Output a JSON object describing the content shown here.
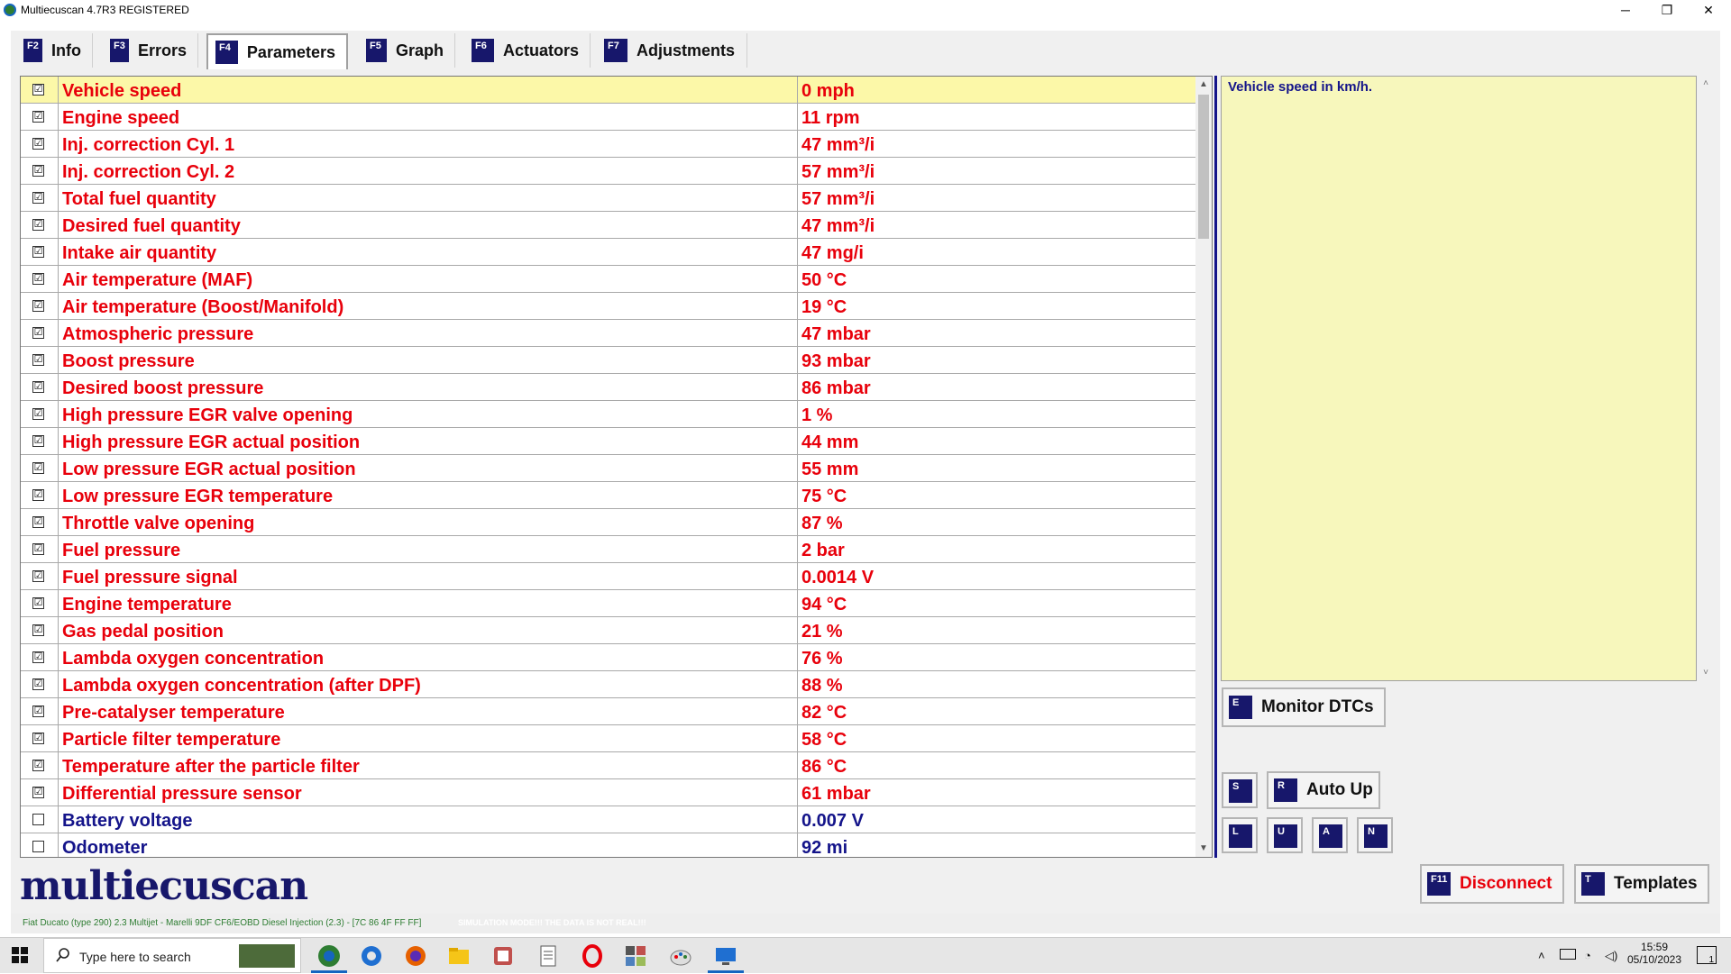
{
  "window": {
    "title": "Multiecuscan 4.7R3 REGISTERED",
    "minimize_glyph": "─",
    "maximize_glyph": "❐",
    "close_glyph": "✕"
  },
  "tabs": [
    {
      "key": "F2",
      "label": "Info"
    },
    {
      "key": "F3",
      "label": "Errors"
    },
    {
      "key": "F4",
      "label": "Parameters"
    },
    {
      "key": "F5",
      "label": "Graph"
    },
    {
      "key": "F6",
      "label": "Actuators"
    },
    {
      "key": "F7",
      "label": "Adjustments"
    }
  ],
  "parameters": [
    {
      "name": "Vehicle speed",
      "value": "0 mph",
      "checked": true,
      "selected": true
    },
    {
      "name": "Engine speed",
      "value": "11 rpm",
      "checked": true
    },
    {
      "name": "Inj. correction Cyl. 1",
      "value": "47 mm³/i",
      "checked": true
    },
    {
      "name": "Inj. correction Cyl. 2",
      "value": "57 mm³/i",
      "checked": true
    },
    {
      "name": "Total fuel quantity",
      "value": "57 mm³/i",
      "checked": true
    },
    {
      "name": "Desired fuel quantity",
      "value": "47 mm³/i",
      "checked": true
    },
    {
      "name": "Intake air quantity",
      "value": "47 mg/i",
      "checked": true
    },
    {
      "name": "Air temperature (MAF)",
      "value": "50 °C",
      "checked": true
    },
    {
      "name": "Air temperature (Boost/Manifold)",
      "value": "19 °C",
      "checked": true
    },
    {
      "name": "Atmospheric pressure",
      "value": "47 mbar",
      "checked": true
    },
    {
      "name": "Boost pressure",
      "value": "93 mbar",
      "checked": true
    },
    {
      "name": "Desired boost pressure",
      "value": "86 mbar",
      "checked": true
    },
    {
      "name": "High pressure EGR valve opening",
      "value": "1 %",
      "checked": true
    },
    {
      "name": "High pressure EGR actual position",
      "value": "44 mm",
      "checked": true
    },
    {
      "name": "Low pressure EGR actual position",
      "value": "55 mm",
      "checked": true
    },
    {
      "name": "Low pressure EGR temperature",
      "value": "75 °C",
      "checked": true
    },
    {
      "name": "Throttle valve opening",
      "value": "87 %",
      "checked": true
    },
    {
      "name": "Fuel pressure",
      "value": "2 bar",
      "checked": true
    },
    {
      "name": "Fuel pressure signal",
      "value": "0.0014 V",
      "checked": true
    },
    {
      "name": "Engine temperature",
      "value": "94 °C",
      "checked": true
    },
    {
      "name": "Gas pedal position",
      "value": "21 %",
      "checked": true
    },
    {
      "name": "Lambda oxygen concentration",
      "value": "76 %",
      "checked": true
    },
    {
      "name": "Lambda oxygen concentration (after DPF)",
      "value": "88 %",
      "checked": true
    },
    {
      "name": "Pre-catalyser temperature",
      "value": "82 °C",
      "checked": true
    },
    {
      "name": "Particle filter temperature",
      "value": "58 °C",
      "checked": true
    },
    {
      "name": "Temperature after the particle filter",
      "value": "86 °C",
      "checked": true
    },
    {
      "name": "Differential pressure sensor",
      "value": "61 mbar",
      "checked": true
    },
    {
      "name": "Battery voltage",
      "value": "0.007 V",
      "checked": false
    },
    {
      "name": "Odometer",
      "value": "92 mi",
      "checked": false
    }
  ],
  "check_glyph": "☑",
  "description": "Vehicle speed in km/h.",
  "buttons": {
    "monitor_dtcs": {
      "key": "E",
      "label": "Monitor DTCs"
    },
    "s": {
      "key": "S"
    },
    "auto_up": {
      "key": "R",
      "label": "Auto Up"
    },
    "l": {
      "key": "L"
    },
    "u": {
      "key": "U"
    },
    "a": {
      "key": "A"
    },
    "n": {
      "key": "N"
    },
    "disconnect": {
      "key": "F11",
      "label": "Disconnect"
    },
    "templates": {
      "key": "T",
      "label": "Templates"
    }
  },
  "logo": "multiecuscan",
  "status": {
    "vehicle": "Fiat Ducato (type 290) 2.3 Multijet - Marelli 9DF CF6/EOBD Diesel Injection (2.3) - [7C 86 4F FF FF]",
    "simulation": "SIMULATION MODE!!! THE DATA IS NOT REAL!!!"
  },
  "taskbar": {
    "search_placeholder": "Type here to search",
    "time": "15:59",
    "date": "05/10/2023",
    "notification_count": "1"
  },
  "colors": {
    "key_badge": "#17176b",
    "checked_param": "#e8000b",
    "unchecked_param": "#14148a",
    "selected_row": "#fcf8a8",
    "description_bg": "#f7f7bc"
  }
}
